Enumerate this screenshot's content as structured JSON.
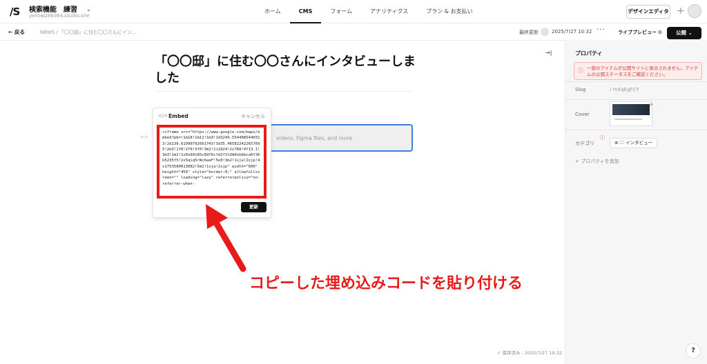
{
  "app": {
    "logo": "/S"
  },
  "site": {
    "title": "検索機能　練習",
    "domain": "yellow286364.studio.site"
  },
  "nav": [
    {
      "label": "ホーム"
    },
    {
      "label": "CMS"
    },
    {
      "label": "フォーム"
    },
    {
      "label": "アナリティクス"
    },
    {
      "label": "プラン & お支払い"
    }
  ],
  "header": {
    "design_editor": "デザインエディタ"
  },
  "subbar": {
    "back": "戻る",
    "breadcrumb": "NEWS  /  「〇〇邸」に住む〇〇さんにイン...",
    "updated_label": "最終更新",
    "updated_date": "2025/7/27 10:32",
    "live_preview": "ライブプレビュー",
    "publish": "公開"
  },
  "editor": {
    "title": "「〇〇邸」に住む〇〇さんにインタビューしました",
    "embed_placeholder": "videos, Figma files, and more"
  },
  "embed_popup": {
    "title": "Embed",
    "cancel": "キャンセル",
    "code": "<iframe src=\"https://www.google.com/maps/embed?pb=!1m18!1m12!1m3!1d3249.5544085440313!2d139.61990792661743!3d35.465822422657695!2m3!1f0!2f0!3f0!3m2!1i1024!2i768!4f13.1!3m3!1m2!1s0x60185c0df6cfd2f1%3A0xbbbca6f36b5235f5!2s5qiq5rWc6aeF!5e0!3m2!1sja!2sjp!4v1753580013082!5m2!1sja!2sjp\" width=\"600\" height=\"450\" style=\"border:0;\" allowfullscreen=\"\" loading=\"lazy\" referrerpolicy=\"no-referrer-when-",
    "update": "更新"
  },
  "annotation": "コピーした埋め込みコードを貼り付ける",
  "properties": {
    "title": "プロパティ",
    "warning": "一部のアイテムが公開サイトに表示されません。アイテムの公開ステータスをご確認ください。",
    "slug_label": "Slug",
    "slug_value": "/ mXqEgFCY",
    "cover_label": "Cover",
    "category_label": "カテゴリ",
    "category_value": "インタビュー",
    "add_property": "プロパティを追加"
  },
  "footer": {
    "saved": "保存済み : 2025/7/27 10:32",
    "help": "?"
  },
  "colors": {
    "accent_red": "#e81b1b",
    "focus_blue": "#3b7ddd"
  }
}
